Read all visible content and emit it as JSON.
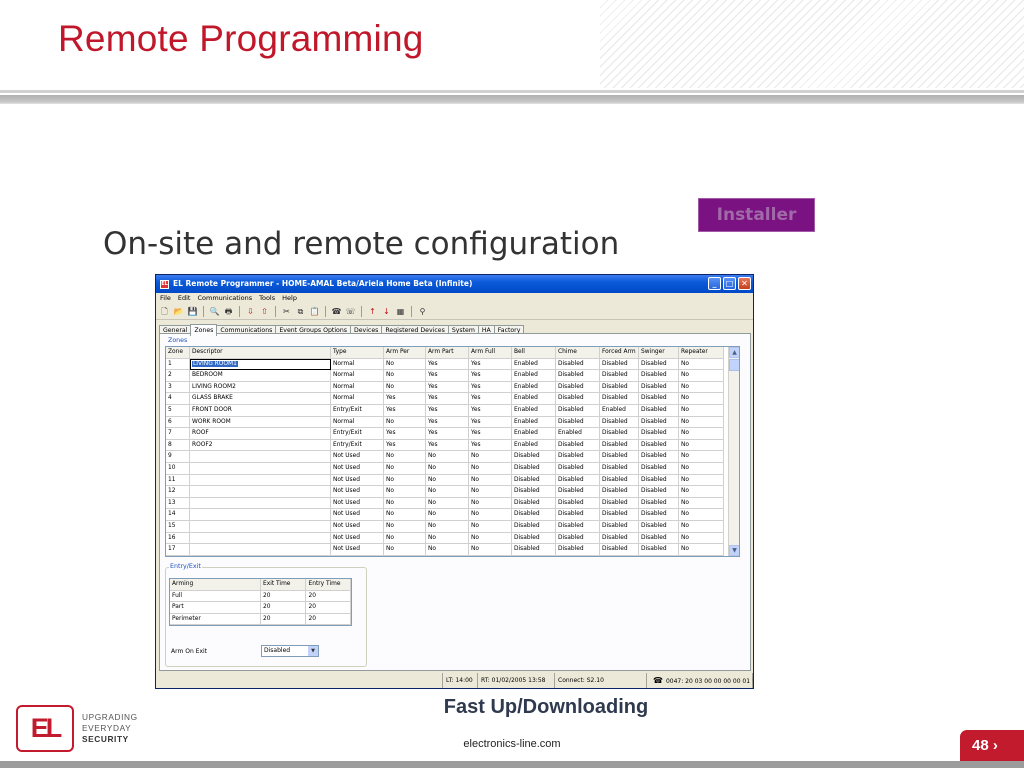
{
  "slide": {
    "title": "Remote Programming",
    "subtitle": "On-site and remote configuration",
    "badge": "Installer",
    "caption": "Fast Up/Downloading",
    "website": "electronics-line.com",
    "page_number": "48",
    "logo_text": "EL",
    "tagline": [
      "UPGRADING",
      "EVERYDAY",
      "SECURITY"
    ],
    "accent_color": "#c0182a",
    "badge_color": "#7a1282"
  },
  "window": {
    "title": "EL Remote Programmer - HOME-AMAL Beta/Ariela Home Beta (Infinite)",
    "menu": [
      "File",
      "Edit",
      "Communications",
      "Tools",
      "Help"
    ],
    "toolbar_icons": [
      "new-icon",
      "open-icon",
      "save-icon",
      "preview-icon",
      "print-icon",
      "download-icon",
      "upload-icon",
      "cut-icon",
      "copy-icon",
      "paste-icon",
      "dial-icon",
      "hangup-icon",
      "arrow-up-icon",
      "arrow-down-icon",
      "calculator-icon",
      "find-icon"
    ],
    "tabs": [
      "General",
      "Zones",
      "Communications",
      "Event Groups Options",
      "Devices",
      "Registered Devices",
      "System",
      "HA",
      "Factory"
    ],
    "active_tab": "Zones",
    "zones_group": "Zones",
    "zones_columns": [
      "Zone",
      "Descriptor",
      "Type",
      "Arm Per",
      "Arm Part",
      "Arm Full",
      "Bell",
      "Chime",
      "Forced Arm",
      "Swinger",
      "Repeater"
    ],
    "zones_rows": [
      [
        "1",
        "LIVING ROOM1",
        "Normal",
        "No",
        "Yes",
        "Yes",
        "Enabled",
        "Disabled",
        "Disabled",
        "Disabled",
        "No"
      ],
      [
        "2",
        "BEDROOM",
        "Normal",
        "No",
        "Yes",
        "Yes",
        "Enabled",
        "Disabled",
        "Disabled",
        "Disabled",
        "No"
      ],
      [
        "3",
        "LIVING ROOM2",
        "Normal",
        "No",
        "Yes",
        "Yes",
        "Enabled",
        "Disabled",
        "Disabled",
        "Disabled",
        "No"
      ],
      [
        "4",
        "GLASS BRAKE",
        "Normal",
        "Yes",
        "Yes",
        "Yes",
        "Enabled",
        "Disabled",
        "Disabled",
        "Disabled",
        "No"
      ],
      [
        "5",
        "FRONT DOOR",
        "Entry/Exit",
        "Yes",
        "Yes",
        "Yes",
        "Enabled",
        "Disabled",
        "Enabled",
        "Disabled",
        "No"
      ],
      [
        "6",
        "WORK ROOM",
        "Normal",
        "No",
        "Yes",
        "Yes",
        "Enabled",
        "Disabled",
        "Disabled",
        "Disabled",
        "No"
      ],
      [
        "7",
        "ROOF",
        "Entry/Exit",
        "Yes",
        "Yes",
        "Yes",
        "Enabled",
        "Enabled",
        "Disabled",
        "Disabled",
        "No"
      ],
      [
        "8",
        "ROOF2",
        "Entry/Exit",
        "Yes",
        "Yes",
        "Yes",
        "Enabled",
        "Disabled",
        "Disabled",
        "Disabled",
        "No"
      ],
      [
        "9",
        "",
        "Not Used",
        "No",
        "No",
        "No",
        "Disabled",
        "Disabled",
        "Disabled",
        "Disabled",
        "No"
      ],
      [
        "10",
        "",
        "Not Used",
        "No",
        "No",
        "No",
        "Disabled",
        "Disabled",
        "Disabled",
        "Disabled",
        "No"
      ],
      [
        "11",
        "",
        "Not Used",
        "No",
        "No",
        "No",
        "Disabled",
        "Disabled",
        "Disabled",
        "Disabled",
        "No"
      ],
      [
        "12",
        "",
        "Not Used",
        "No",
        "No",
        "No",
        "Disabled",
        "Disabled",
        "Disabled",
        "Disabled",
        "No"
      ],
      [
        "13",
        "",
        "Not Used",
        "No",
        "No",
        "No",
        "Disabled",
        "Disabled",
        "Disabled",
        "Disabled",
        "No"
      ],
      [
        "14",
        "",
        "Not Used",
        "No",
        "No",
        "No",
        "Disabled",
        "Disabled",
        "Disabled",
        "Disabled",
        "No"
      ],
      [
        "15",
        "",
        "Not Used",
        "No",
        "No",
        "No",
        "Disabled",
        "Disabled",
        "Disabled",
        "Disabled",
        "No"
      ],
      [
        "16",
        "",
        "Not Used",
        "No",
        "No",
        "No",
        "Disabled",
        "Disabled",
        "Disabled",
        "Disabled",
        "No"
      ],
      [
        "17",
        "",
        "Not Used",
        "No",
        "No",
        "No",
        "Disabled",
        "Disabled",
        "Disabled",
        "Disabled",
        "No"
      ]
    ],
    "entry_exit_group": "Entry/Exit",
    "entry_columns": [
      "Arming",
      "Exit Time",
      "Entry Time"
    ],
    "entry_rows": [
      [
        "Full",
        "20",
        "20"
      ],
      [
        "Part",
        "20",
        "20"
      ],
      [
        "Perimeter",
        "20",
        "20"
      ]
    ],
    "arm_on_exit_label": "Arm On Exit",
    "arm_on_exit_value": "Disabled",
    "status": [
      "",
      "LT: 14:00",
      "RT: 01/02/2005 13:58",
      "Connect: S2.10",
      "0047: 20 03 00 00 00 00 01 !"
    ]
  }
}
